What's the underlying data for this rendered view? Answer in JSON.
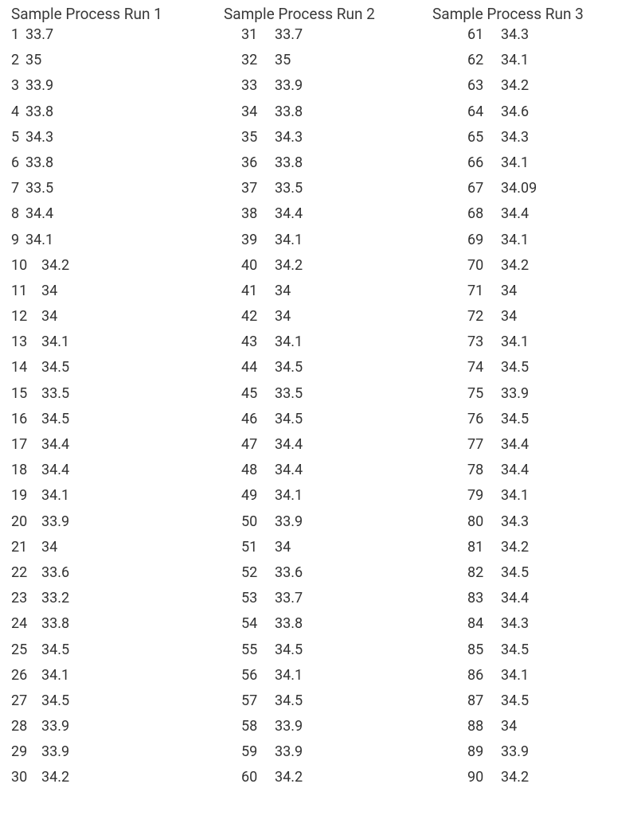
{
  "columns": [
    {
      "header": "Sample Process Run 1",
      "rows": [
        {
          "sample": "1",
          "value": "33.7"
        },
        {
          "sample": "2",
          "value": "35"
        },
        {
          "sample": "3",
          "value": "33.9"
        },
        {
          "sample": "4",
          "value": "33.8"
        },
        {
          "sample": "5",
          "value": "34.3"
        },
        {
          "sample": "6",
          "value": "33.8"
        },
        {
          "sample": "7",
          "value": "33.5"
        },
        {
          "sample": "8",
          "value": "34.4"
        },
        {
          "sample": "9",
          "value": "34.1"
        },
        {
          "sample": "10",
          "value": "34.2"
        },
        {
          "sample": "11",
          "value": "34"
        },
        {
          "sample": "12",
          "value": "34"
        },
        {
          "sample": "13",
          "value": "34.1"
        },
        {
          "sample": "14",
          "value": "34.5"
        },
        {
          "sample": "15",
          "value": "33.5"
        },
        {
          "sample": "16",
          "value": "34.5"
        },
        {
          "sample": "17",
          "value": "34.4"
        },
        {
          "sample": "18",
          "value": "34.4"
        },
        {
          "sample": "19",
          "value": "34.1"
        },
        {
          "sample": "20",
          "value": "33.9"
        },
        {
          "sample": "21",
          "value": "34"
        },
        {
          "sample": "22",
          "value": "33.6"
        },
        {
          "sample": "23",
          "value": "33.2"
        },
        {
          "sample": "24",
          "value": "33.8"
        },
        {
          "sample": "25",
          "value": "34.5"
        },
        {
          "sample": "26",
          "value": "34.1"
        },
        {
          "sample": "27",
          "value": "34.5"
        },
        {
          "sample": "28",
          "value": "33.9"
        },
        {
          "sample": "29",
          "value": "33.9"
        },
        {
          "sample": "30",
          "value": "34.2"
        }
      ]
    },
    {
      "header": "Sample Process Run 2",
      "rows": [
        {
          "sample": "31",
          "value": "33.7"
        },
        {
          "sample": "32",
          "value": "35"
        },
        {
          "sample": "33",
          "value": "33.9"
        },
        {
          "sample": "34",
          "value": "33.8"
        },
        {
          "sample": "35",
          "value": "34.3"
        },
        {
          "sample": "36",
          "value": "33.8"
        },
        {
          "sample": "37",
          "value": "33.5"
        },
        {
          "sample": "38",
          "value": "34.4"
        },
        {
          "sample": "39",
          "value": "34.1"
        },
        {
          "sample": "40",
          "value": "34.2"
        },
        {
          "sample": "41",
          "value": "34"
        },
        {
          "sample": "42",
          "value": "34"
        },
        {
          "sample": "43",
          "value": "34.1"
        },
        {
          "sample": "44",
          "value": "34.5"
        },
        {
          "sample": "45",
          "value": "33.5"
        },
        {
          "sample": "46",
          "value": "34.5"
        },
        {
          "sample": "47",
          "value": "34.4"
        },
        {
          "sample": "48",
          "value": "34.4"
        },
        {
          "sample": "49",
          "value": "34.1"
        },
        {
          "sample": "50",
          "value": "33.9"
        },
        {
          "sample": "51",
          "value": "34"
        },
        {
          "sample": "52",
          "value": "33.6"
        },
        {
          "sample": "53",
          "value": "33.7"
        },
        {
          "sample": "54",
          "value": "33.8"
        },
        {
          "sample": "55",
          "value": "34.5"
        },
        {
          "sample": "56",
          "value": "34.1"
        },
        {
          "sample": "57",
          "value": "34.5"
        },
        {
          "sample": "58",
          "value": "33.9"
        },
        {
          "sample": "59",
          "value": "33.9"
        },
        {
          "sample": "60",
          "value": "34.2"
        }
      ]
    },
    {
      "header": "Sample Process Run 3",
      "rows": [
        {
          "sample": "61",
          "value": "34.3"
        },
        {
          "sample": "62",
          "value": "34.1"
        },
        {
          "sample": "63",
          "value": "34.2"
        },
        {
          "sample": "64",
          "value": "34.6"
        },
        {
          "sample": "65",
          "value": "34.3"
        },
        {
          "sample": "66",
          "value": "34.1"
        },
        {
          "sample": "67",
          "value": "34.09"
        },
        {
          "sample": "68",
          "value": "34.4"
        },
        {
          "sample": "69",
          "value": "34.1"
        },
        {
          "sample": "70",
          "value": "34.2"
        },
        {
          "sample": "71",
          "value": "34"
        },
        {
          "sample": "72",
          "value": "34"
        },
        {
          "sample": "73",
          "value": "34.1"
        },
        {
          "sample": "74",
          "value": "34.5"
        },
        {
          "sample": "75",
          "value": "33.9"
        },
        {
          "sample": "76",
          "value": "34.5"
        },
        {
          "sample": "77",
          "value": "34.4"
        },
        {
          "sample": "78",
          "value": "34.4"
        },
        {
          "sample": "79",
          "value": "34.1"
        },
        {
          "sample": "80",
          "value": "34.3"
        },
        {
          "sample": "81",
          "value": "34.2"
        },
        {
          "sample": "82",
          "value": "34.5"
        },
        {
          "sample": "83",
          "value": "34.4"
        },
        {
          "sample": "84",
          "value": "34.3"
        },
        {
          "sample": "85",
          "value": "34.5"
        },
        {
          "sample": "86",
          "value": "34.1"
        },
        {
          "sample": "87",
          "value": "34.5"
        },
        {
          "sample": "88",
          "value": "34"
        },
        {
          "sample": "89",
          "value": "33.9"
        },
        {
          "sample": "90",
          "value": "34.2"
        }
      ]
    }
  ],
  "chart_data": {
    "type": "table",
    "title": "",
    "series": [
      {
        "name": "Process Run 1",
        "x": [
          1,
          2,
          3,
          4,
          5,
          6,
          7,
          8,
          9,
          10,
          11,
          12,
          13,
          14,
          15,
          16,
          17,
          18,
          19,
          20,
          21,
          22,
          23,
          24,
          25,
          26,
          27,
          28,
          29,
          30
        ],
        "values": [
          33.7,
          35,
          33.9,
          33.8,
          34.3,
          33.8,
          33.5,
          34.4,
          34.1,
          34.2,
          34,
          34,
          34.1,
          34.5,
          33.5,
          34.5,
          34.4,
          34.4,
          34.1,
          33.9,
          34,
          33.6,
          33.2,
          33.8,
          34.5,
          34.1,
          34.5,
          33.9,
          33.9,
          34.2
        ]
      },
      {
        "name": "Process Run 2",
        "x": [
          31,
          32,
          33,
          34,
          35,
          36,
          37,
          38,
          39,
          40,
          41,
          42,
          43,
          44,
          45,
          46,
          47,
          48,
          49,
          50,
          51,
          52,
          53,
          54,
          55,
          56,
          57,
          58,
          59,
          60
        ],
        "values": [
          33.7,
          35,
          33.9,
          33.8,
          34.3,
          33.8,
          33.5,
          34.4,
          34.1,
          34.2,
          34,
          34,
          34.1,
          34.5,
          33.5,
          34.5,
          34.4,
          34.4,
          34.1,
          33.9,
          34,
          33.6,
          33.7,
          33.8,
          34.5,
          34.1,
          34.5,
          33.9,
          33.9,
          34.2
        ]
      },
      {
        "name": "Process Run 3",
        "x": [
          61,
          62,
          63,
          64,
          65,
          66,
          67,
          68,
          69,
          70,
          71,
          72,
          73,
          74,
          75,
          76,
          77,
          78,
          79,
          80,
          81,
          82,
          83,
          84,
          85,
          86,
          87,
          88,
          89,
          90
        ],
        "values": [
          34.3,
          34.1,
          34.2,
          34.6,
          34.3,
          34.1,
          34.09,
          34.4,
          34.1,
          34.2,
          34,
          34,
          34.1,
          34.5,
          33.9,
          34.5,
          34.4,
          34.4,
          34.1,
          34.3,
          34.2,
          34.5,
          34.4,
          34.3,
          34.5,
          34.1,
          34.5,
          34,
          33.9,
          34.2
        ]
      }
    ]
  }
}
